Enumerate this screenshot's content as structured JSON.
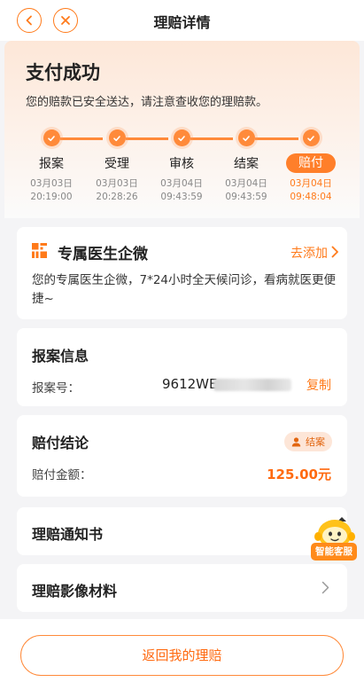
{
  "header": {
    "title": "理赔详情"
  },
  "status": {
    "title": "支付成功",
    "subtitle": "您的赔款已安全送达，请注意查收您的理赔款。",
    "steps": [
      {
        "label": "报案",
        "date": "03月03日",
        "time": "20:19:00"
      },
      {
        "label": "受理",
        "date": "03月03日",
        "time": "20:28:26"
      },
      {
        "label": "审核",
        "date": "03月04日",
        "time": "09:43:59"
      },
      {
        "label": "结案",
        "date": "03月04日",
        "time": "09:43:59"
      },
      {
        "label": "赔付",
        "date": "03月04日",
        "time": "09:48:04"
      }
    ],
    "active_step": 4
  },
  "doctor": {
    "title": "专属医生企微",
    "action": "去添加",
    "description": "您的专属医生企微，7*24小时全天候问诊，看病就医更便捷~"
  },
  "report": {
    "title": "报案信息",
    "number_label": "报案号：",
    "number_visible": "9612WE",
    "copy_label": "复制"
  },
  "result": {
    "title": "赔付结论",
    "badge": "结案",
    "amount_label": "赔付金额：",
    "amount": "125.00元"
  },
  "notice": {
    "title": "理赔通知书"
  },
  "media": {
    "title": "理赔影像材料"
  },
  "assistant": {
    "label": "智能客服"
  },
  "footer": {
    "button": "返回我的理赔"
  },
  "colors": {
    "accent": "#ff7a1a",
    "accent_light": "#fde6d8",
    "background": "#f4f4f6"
  }
}
